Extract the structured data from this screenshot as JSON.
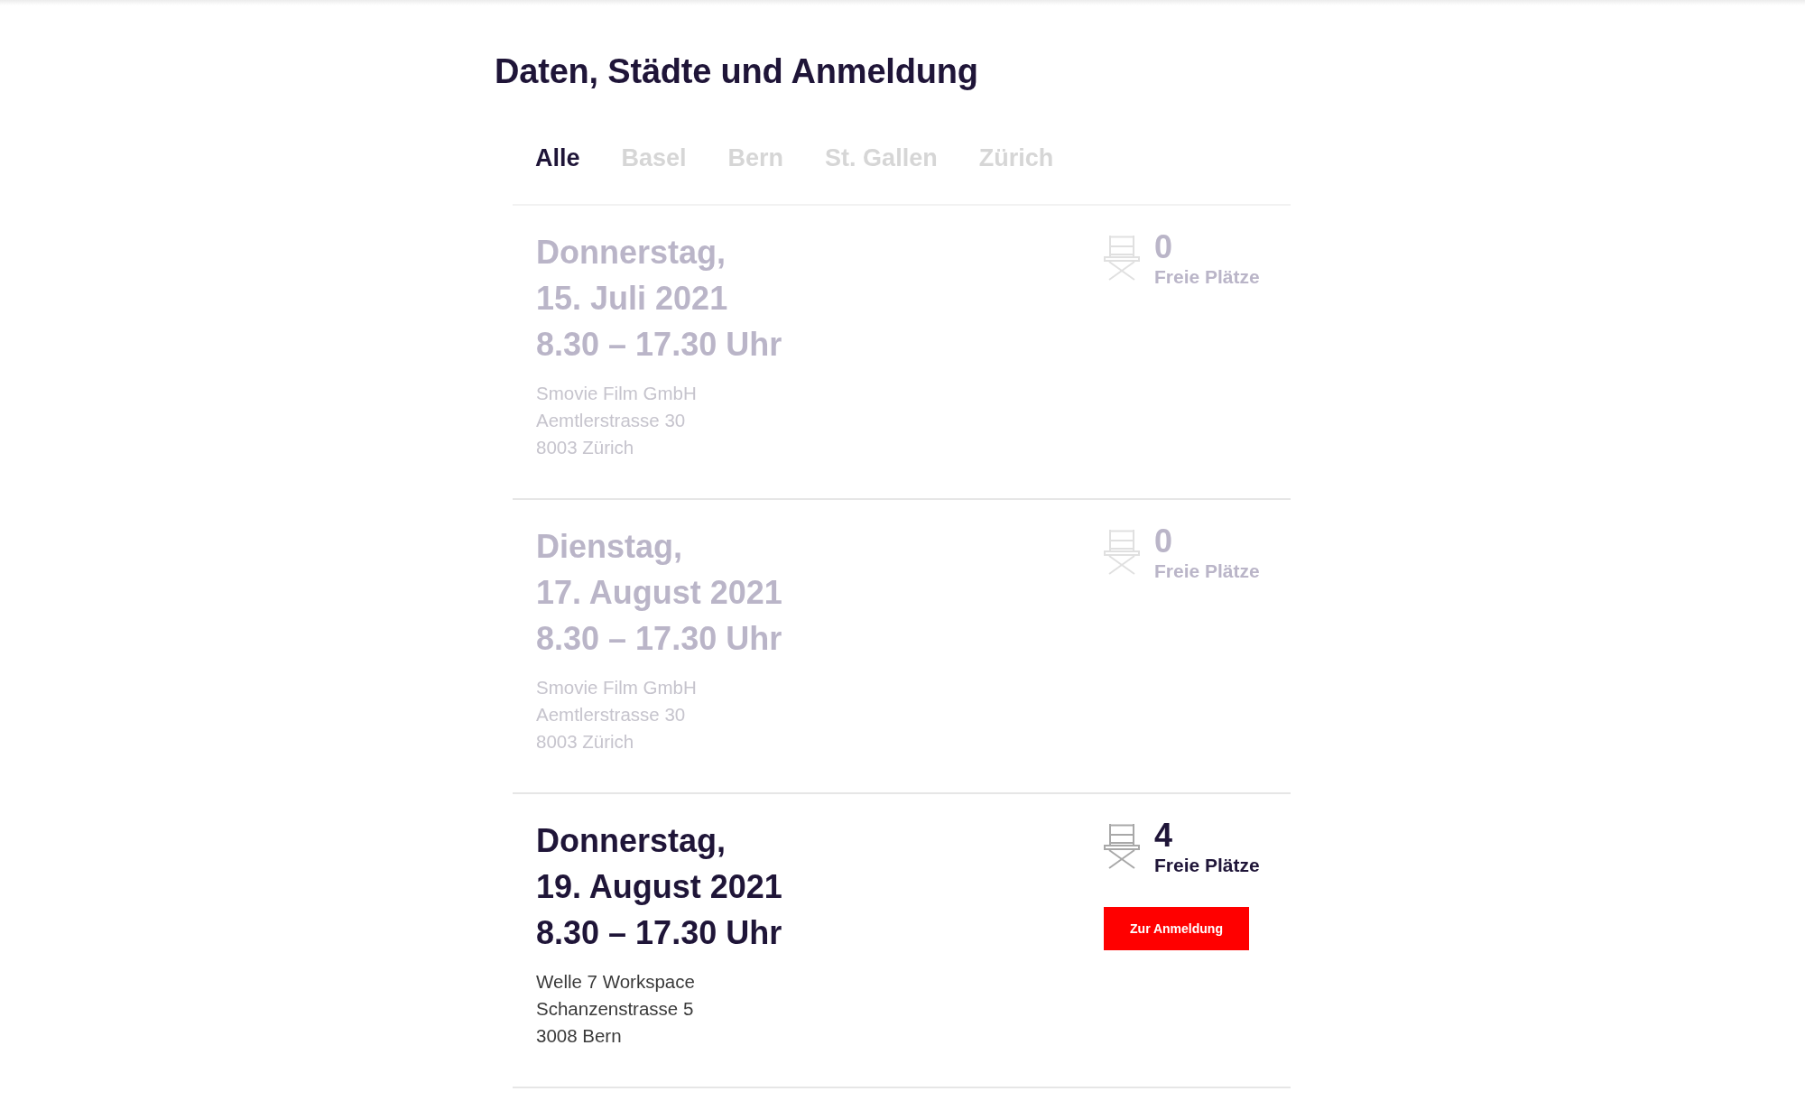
{
  "heading": "Daten, Städte und Anmeldung",
  "tabs": [
    {
      "label": "Alle",
      "selected": true
    },
    {
      "label": "Basel",
      "selected": false
    },
    {
      "label": "Bern",
      "selected": false
    },
    {
      "label": "St. Gallen",
      "selected": false
    },
    {
      "label": "Zürich",
      "selected": false
    }
  ],
  "events": [
    {
      "day": "Donnerstag,",
      "date": "15. Juli 2021",
      "time": "8.30 – 17.30 Uhr",
      "address": [
        "Smovie Film GmbH",
        "Aemtlerstrasse 30",
        "8003 Zürich"
      ],
      "seats": "0",
      "seats_label": "Freie Plätze",
      "disabled": true
    },
    {
      "day": "Dienstag,",
      "date": "17. August 2021",
      "time": "8.30 – 17.30 Uhr",
      "address": [
        "Smovie Film GmbH",
        "Aemtlerstrasse 30",
        "8003 Zürich"
      ],
      "seats": "0",
      "seats_label": "Freie Plätze",
      "disabled": true
    },
    {
      "day": "Donnerstag,",
      "date": "19. August 2021",
      "time": "8.30 – 17.30 Uhr",
      "address": [
        "Welle 7 Workspace",
        "Schanzenstrasse 5",
        "3008 Bern"
      ],
      "seats": "4",
      "seats_label": "Freie Plätze",
      "disabled": false,
      "button": "Zur Anmeldung"
    }
  ]
}
